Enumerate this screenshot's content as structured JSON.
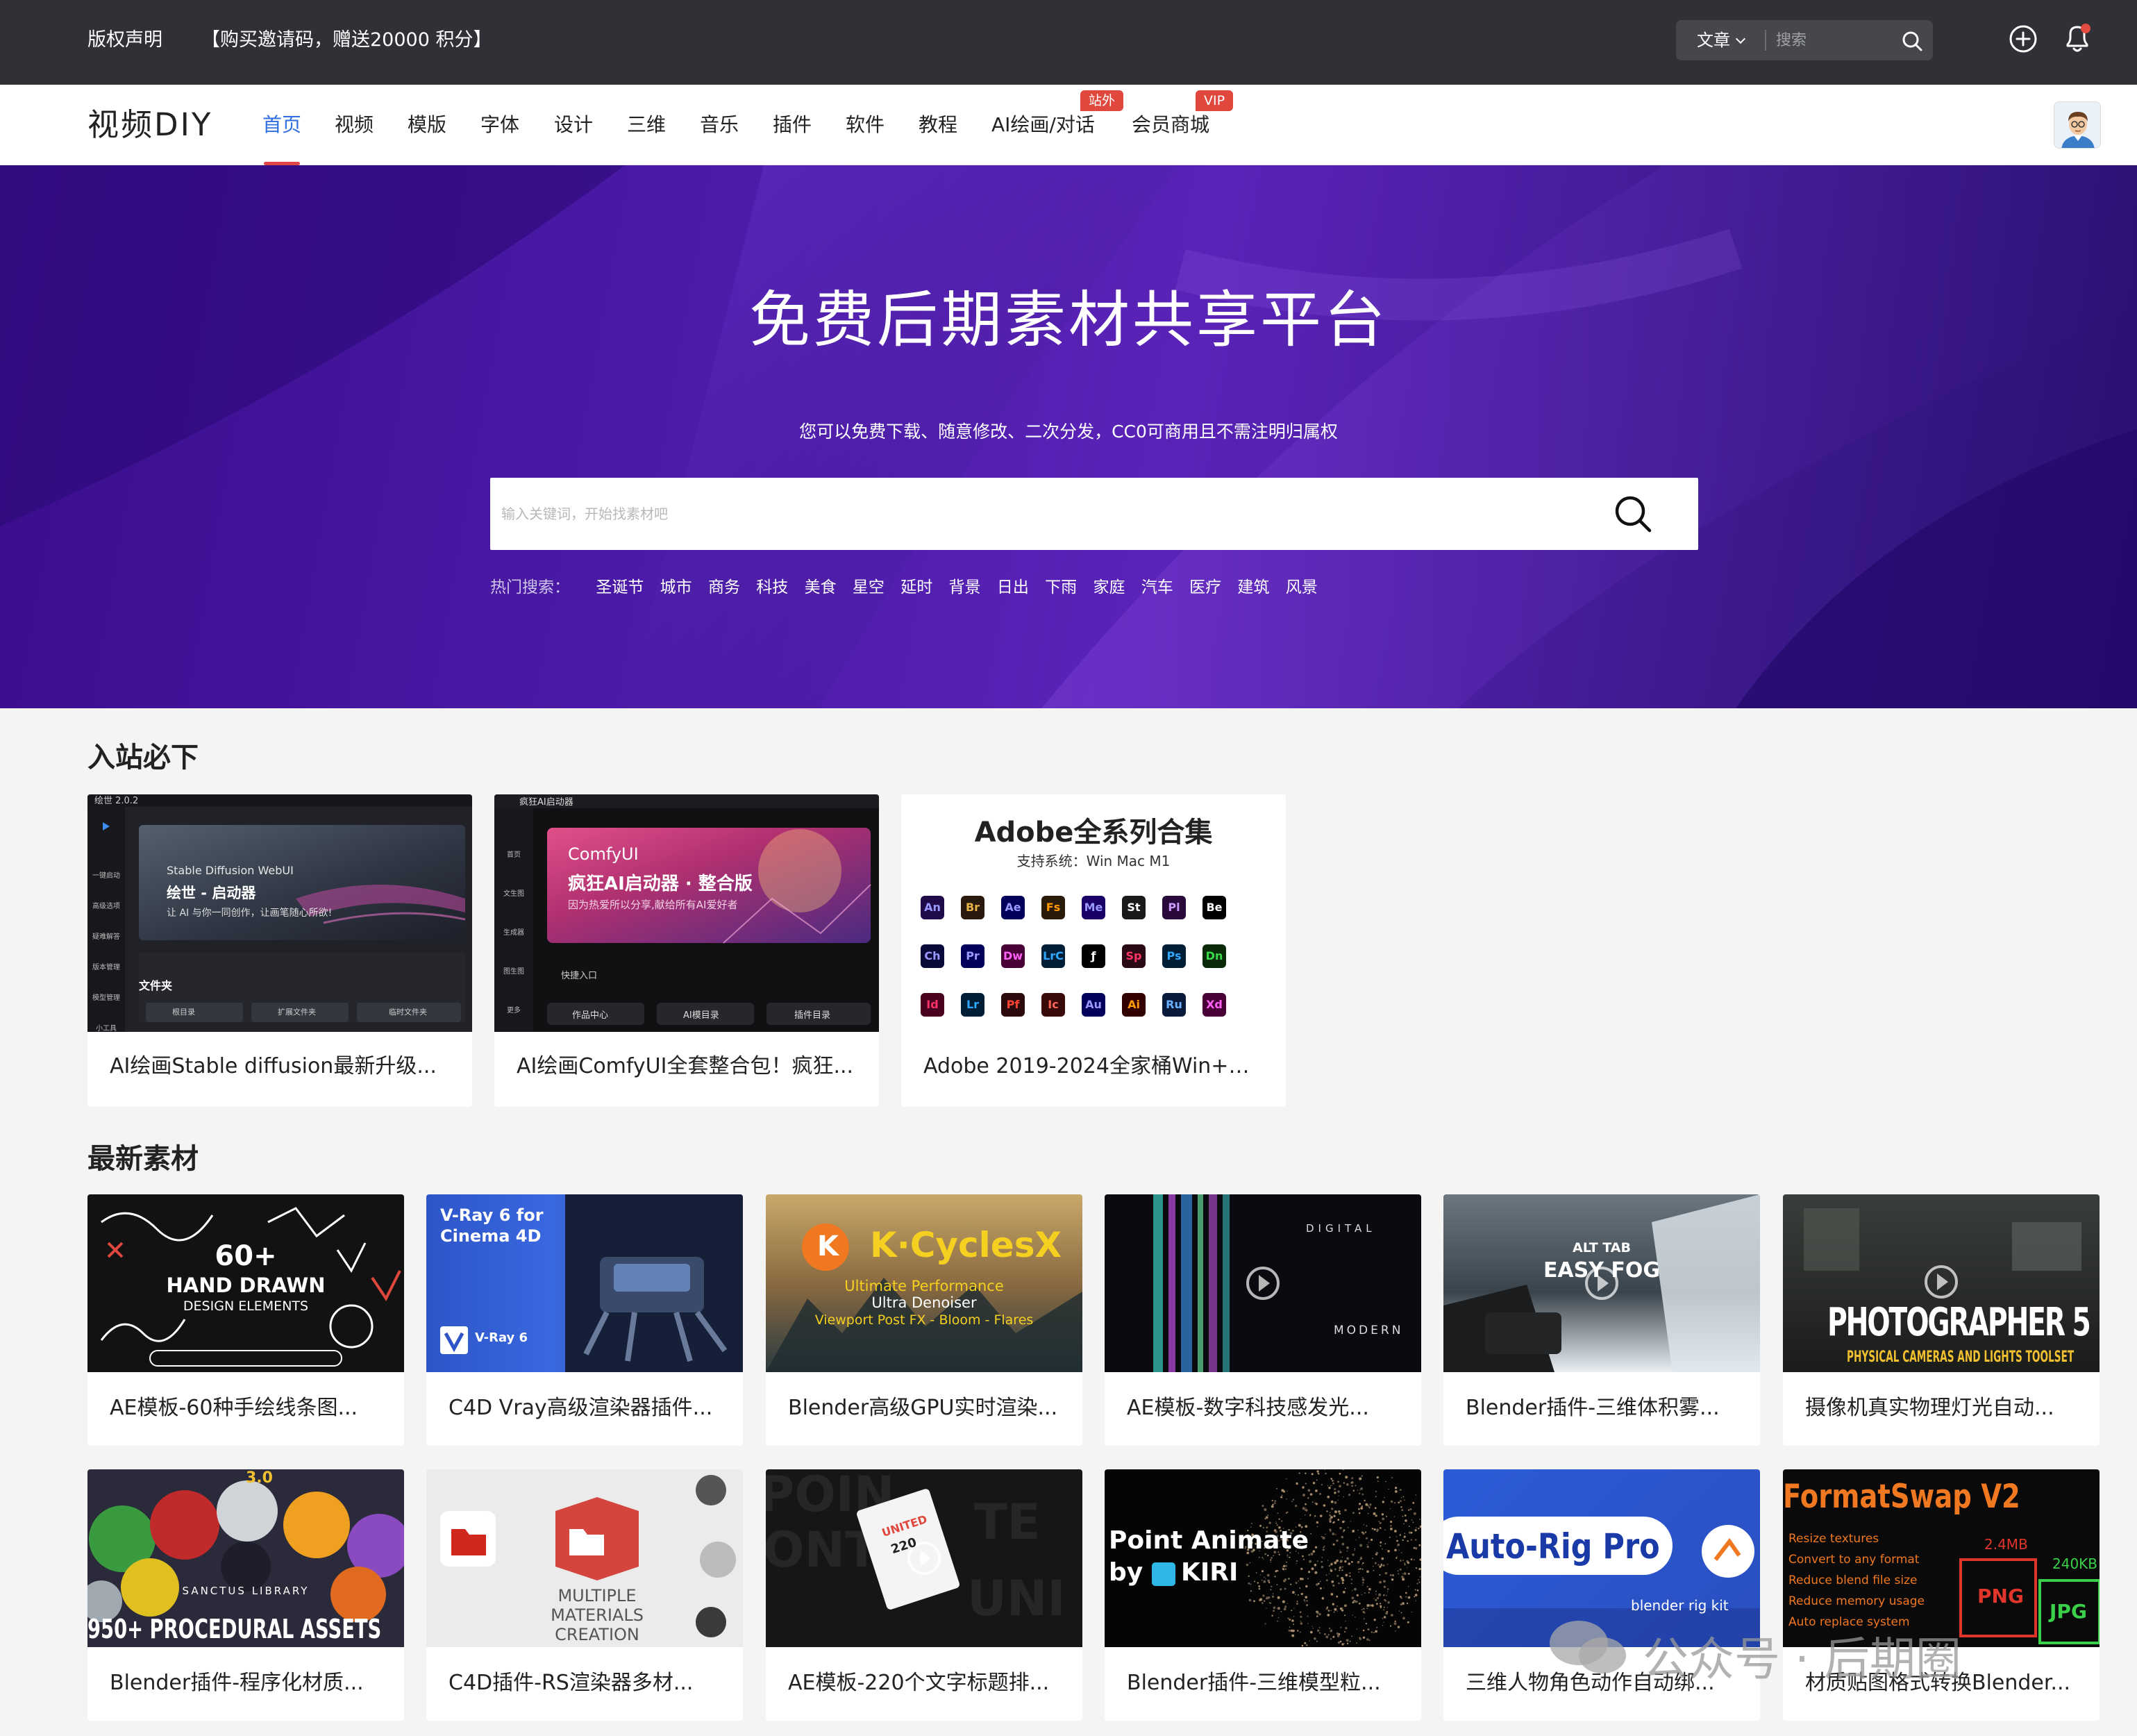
{
  "topbar": {
    "copyright": "版权声明",
    "promo": "【购买邀请码，赠送20000 积分】",
    "search_category": "文章",
    "search_placeholder": "搜索"
  },
  "nav": {
    "logo": "视频DIY",
    "items": [
      "首页",
      "视频",
      "模版",
      "字体",
      "设计",
      "三维",
      "音乐",
      "插件",
      "软件",
      "教程",
      "AI绘画/对话",
      "会员商城"
    ],
    "badges": {
      "ai": "站外",
      "shop": "VIP"
    }
  },
  "hero": {
    "title": "免费后期素材共享平台",
    "subtitle": "您可以免费下载、随意修改、二次分发，CC0可商用且不需注明归属权",
    "search_placeholder": "输入关键词，开始找素材吧",
    "hot_label": "热门搜索：",
    "hot_items": [
      "圣诞节",
      "城市",
      "商务",
      "科技",
      "美食",
      "星空",
      "延时",
      "背景",
      "日出",
      "下雨",
      "家庭",
      "汽车",
      "医疗",
      "建筑",
      "风景"
    ]
  },
  "must": {
    "title": "入站必下",
    "cards": [
      {
        "title": "AI绘画Stable diffusion最新升级...",
        "thumb_header": "绘世 2.0.2",
        "thumb_small": "Stable Diffusion WebUI",
        "thumb_big": "绘世 - 启动器",
        "thumb_line": "让 AI 与你一同创作，让画笔随心所欲!",
        "thumb_folder": "文件夹",
        "thumb_btns": [
          "根目录",
          "扩展文件夹",
          "临时文件夹"
        ],
        "thumb_sidebar": [
          "一键启动",
          "高级选项",
          "疑难解答",
          "版本管理",
          "模型管理",
          "小工具"
        ]
      },
      {
        "title": "AI绘画ComfyUI全套整合包！疯狂...",
        "thumb_header": "疯狂AI启动器",
        "thumb_small": "ComfyUI",
        "thumb_big": "疯狂AI启动器 · 整合版",
        "thumb_line": "因为热爱所以分享,献给所有AI爱好者",
        "thumb_quick": "快捷入口",
        "thumb_btns": [
          "作品中心",
          "AI模目录",
          "插件目录"
        ],
        "thumb_sidebar": [
          "首页",
          "文生图",
          "生成器",
          "图生图",
          "更多"
        ]
      },
      {
        "title": "Adobe 2019-2024全家桶Win+M...",
        "thumb_big": "Adobe全系列合集",
        "thumb_line": "支持系统：Win Mac M1",
        "apps": [
          "An",
          "Br",
          "Ae",
          "Fs",
          "Me",
          "St",
          "Pl",
          "Be",
          "Ch",
          "Pr",
          "Dw",
          "LrC",
          "ƒ",
          "Sp",
          "Ps",
          "Dn",
          "Id",
          "Lr",
          "Pf",
          "Ic",
          "Au",
          "Ai",
          "Ru",
          "Xd"
        ]
      }
    ]
  },
  "latest": {
    "title": "最新素材",
    "cards": [
      {
        "title": "AE模板-60种手绘线条图...",
        "thumb_text": [
          "60+",
          "HAND DRAWN",
          "DESIGN ELEMENTS"
        ]
      },
      {
        "title": "C4D Vray高级渲染器插件...",
        "thumb_text": [
          "V-Ray 6 for",
          "Cinema 4D",
          "V-Ray 6"
        ]
      },
      {
        "title": "Blender高级GPU实时渲染...",
        "thumb_text": [
          "K·CyclesX",
          "Ultimate Performance",
          "Ultra Denoiser",
          "Viewport Post FX - Bloom - Flares"
        ]
      },
      {
        "title": "AE模板-数字科技感发光...",
        "thumb_text": [
          "DIGITAL",
          "MODERN"
        ]
      },
      {
        "title": "Blender插件-三维体积雾...",
        "thumb_text": [
          "ALT TAB",
          "EASY FOG"
        ]
      },
      {
        "title": "摄像机真实物理灯光自动...",
        "thumb_text": [
          "PHOTOGRAPHER 5",
          "PHYSICAL CAMERAS AND LIGHTS TOOLSET"
        ]
      },
      {
        "title": "Blender插件-程序化材质...",
        "thumb_text": [
          "3.0",
          "SANCTUS LIBRARY",
          "950+ PROCEDURAL ASSETS"
        ]
      },
      {
        "title": "C4D插件-RS渲染器多材...",
        "thumb_text": [
          "MULTIPLE",
          "MATERIALS",
          "CREATION"
        ]
      },
      {
        "title": "AE模板-220个文字标题排...",
        "thumb_text": [
          "UNITED",
          "220"
        ]
      },
      {
        "title": "Blender插件-三维模型粒...",
        "thumb_text": [
          "Point Animate",
          "by",
          "KIRI"
        ]
      },
      {
        "title": "三维人物角色动作自动绑...",
        "thumb_text": [
          "Auto-Rig Pro",
          "blender rig kit"
        ]
      },
      {
        "title": "材质贴图格式转换Blender...",
        "thumb_text": [
          "FormatSwap V2",
          "Resize textures",
          "Convert to any format",
          "Reduce blend file size",
          "Reduce memory usage",
          "Auto replace system",
          "2.4MB",
          "240KB",
          "PNG",
          "JPG"
        ]
      }
    ]
  },
  "watermark": "公众号 · 后期圈",
  "colors": {
    "topbar": "#2f3136",
    "accent": "#2f6ee0",
    "badge": "#e0483e",
    "hero": "#4a1aa6"
  }
}
